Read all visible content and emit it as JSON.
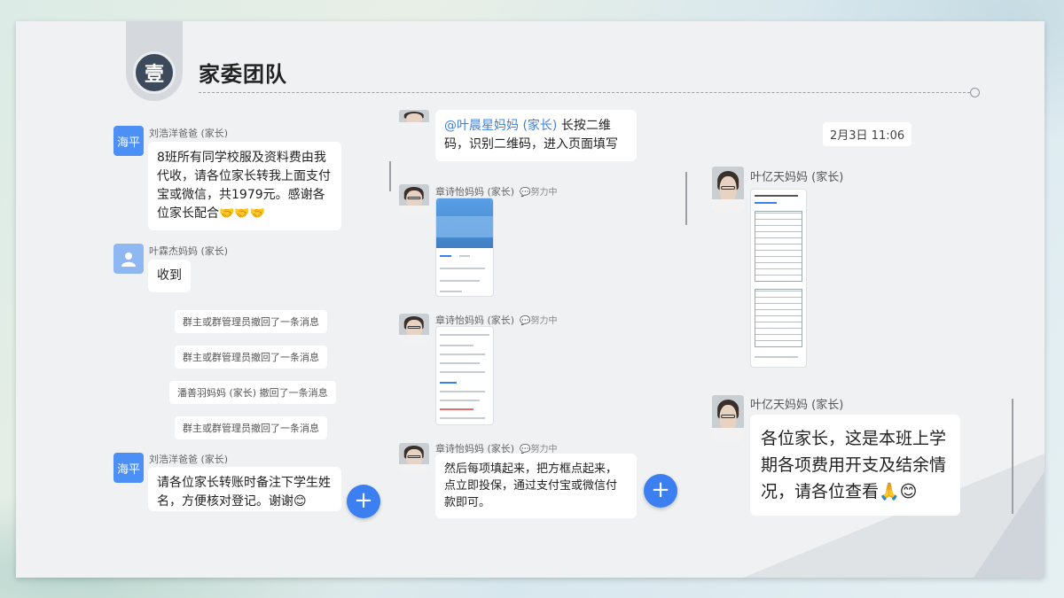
{
  "slide": {
    "badge": "壹",
    "title": "家委团队"
  },
  "left": {
    "messages": [
      {
        "avatar": "海平",
        "name": "刘浩洋爸爸 (家长)",
        "text": "8班所有同学校服及资料费由我代收，请各位家长转我上面支付宝或微信，共1979元。感谢各位家长配合🤝🤝🤝"
      },
      {
        "avatar": "",
        "name": "叶霖杰妈妈 (家长)",
        "text": "收到"
      },
      {
        "avatar": "海平",
        "name": "刘浩洋爸爸 (家长)",
        "text": "请各位家长转账时备注下学生姓名，方便核对登记。谢谢😊"
      }
    ],
    "system": [
      "群主或群管理员撤回了一条消息",
      "群主或群管理员撤回了一条消息",
      "潘善羽妈妈 (家长) 撤回了一条消息",
      "群主或群管理员撤回了一条消息"
    ]
  },
  "middle": {
    "top_bubble_mention": "@叶晨星妈妈 (家长)",
    "top_bubble_text": " 长按二维码，识别二维码，进入页面填写",
    "sender_name": "章诗怡妈妈 (家长)",
    "sender_status": "💬努力中",
    "bottom_text": "然后每项填起来，把方框点起来，点立即投保，通过支付宝或微信付款即可。"
  },
  "right": {
    "time": "2月3日 11:06",
    "sender_name": "叶亿天妈妈 (家长)",
    "message": "各位家长，这是本班上学期各项费用开支及结余情况，请各位查看🙏😊"
  },
  "plus_label": "+",
  "colors": {
    "accent": "#3b7ff0",
    "avatar_blue": "#4c8ff5",
    "badge": "#3d4a5c"
  }
}
